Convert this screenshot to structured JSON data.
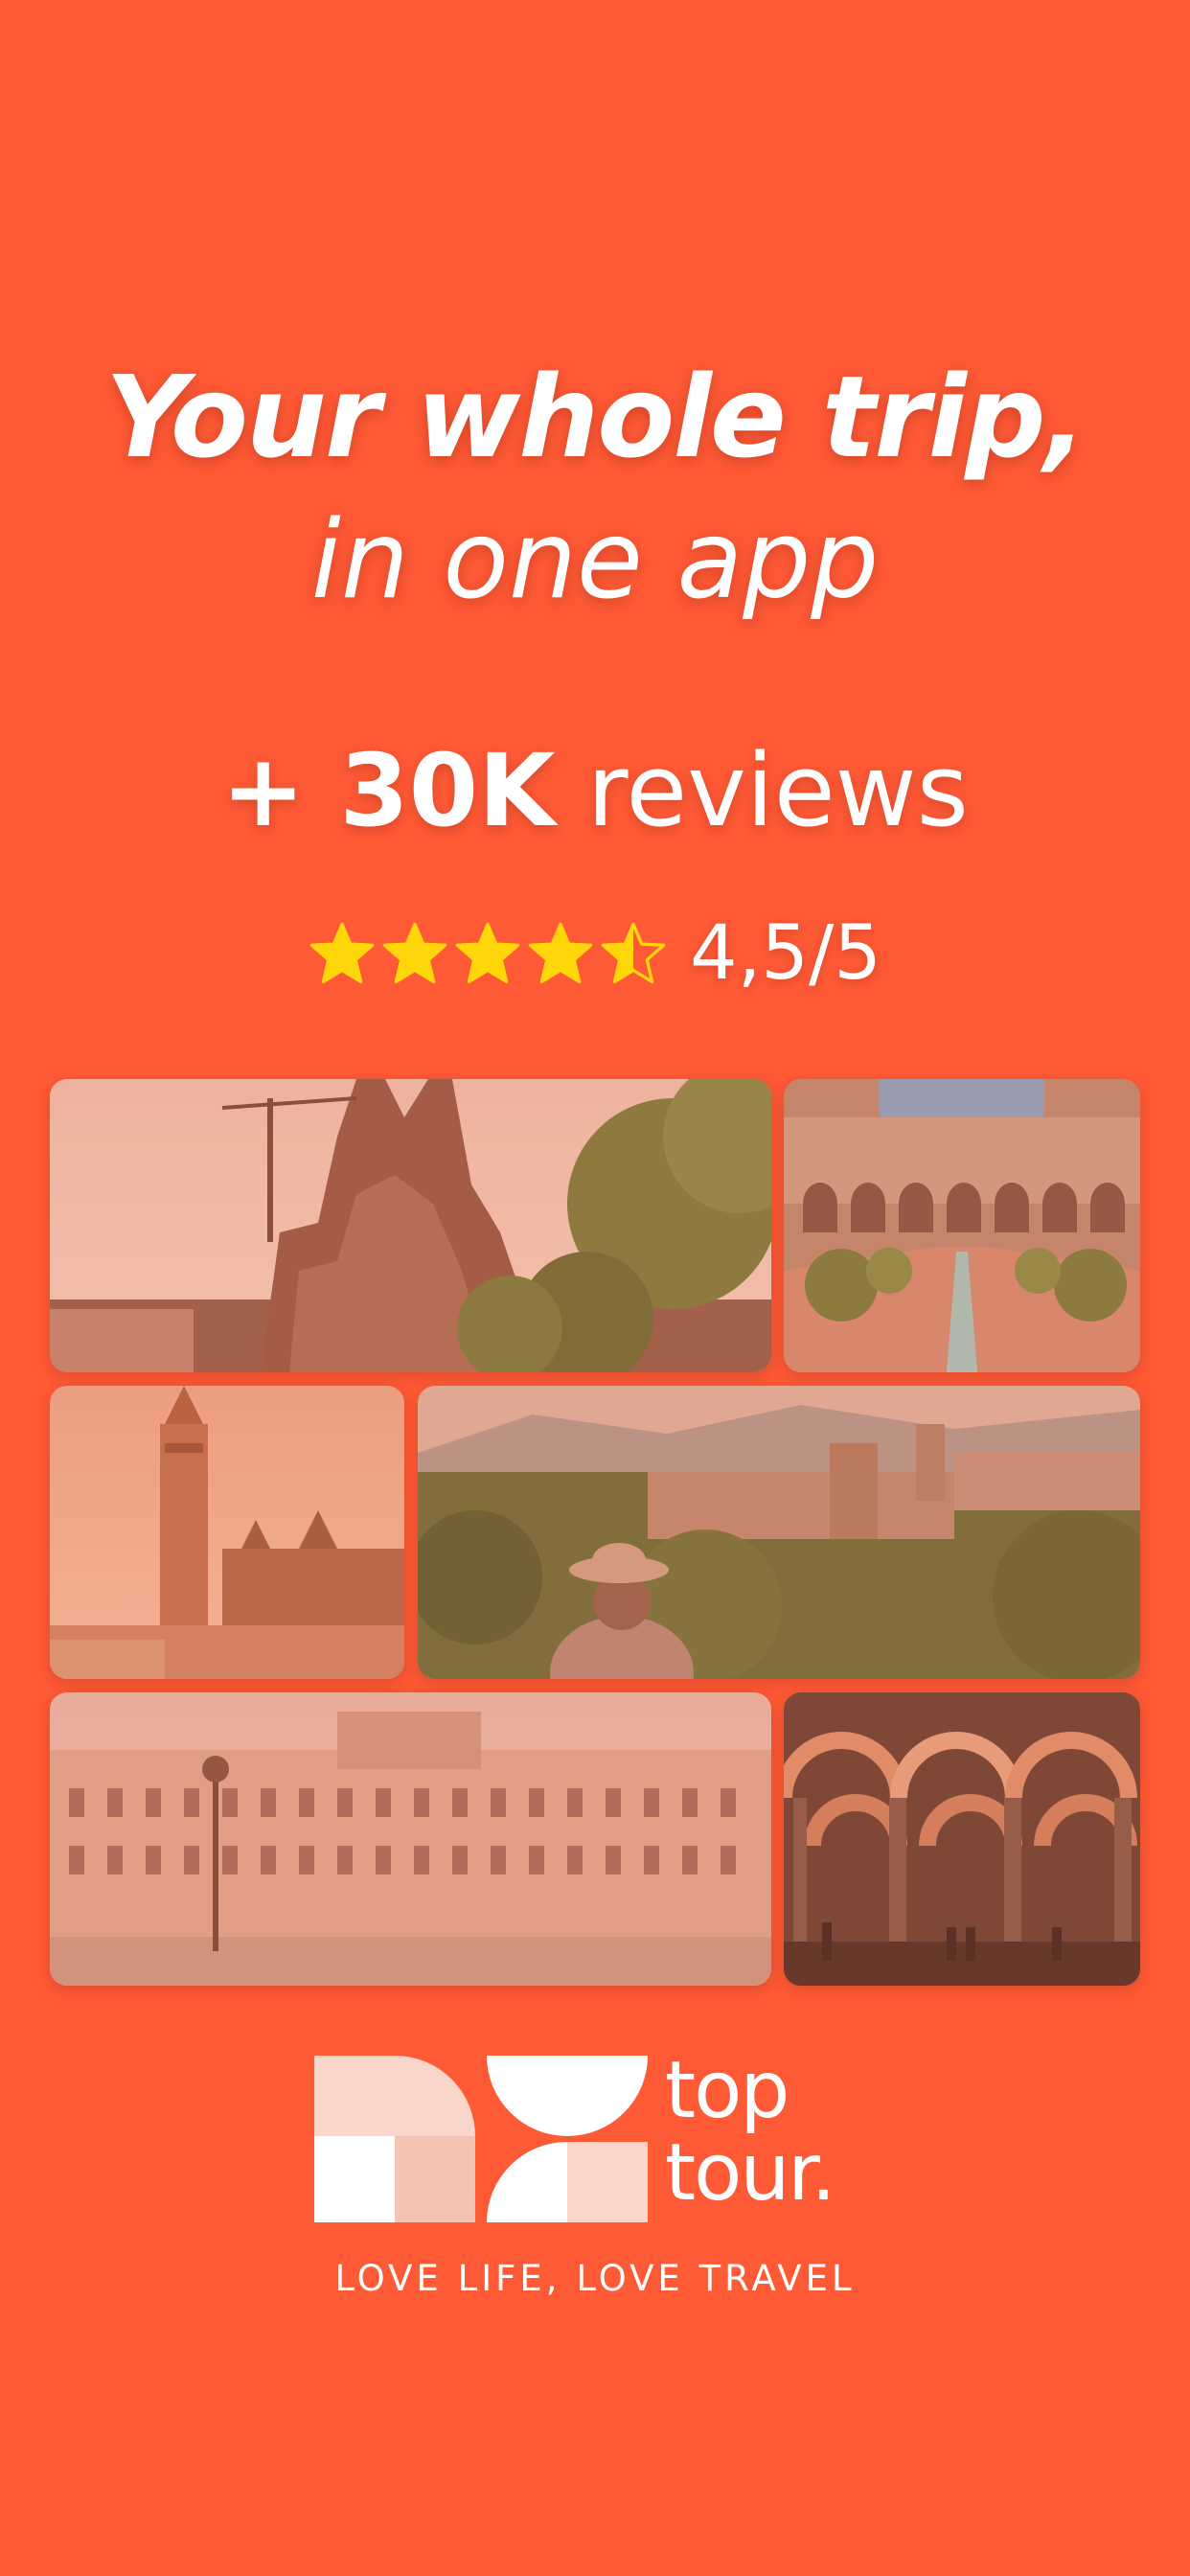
{
  "headline": {
    "line1": "Your whole trip,",
    "line2": "in one app"
  },
  "reviews": {
    "prefix": "+ 30K",
    "suffix": " reviews"
  },
  "rating": {
    "stars_value": 4.5,
    "stars_max": 5,
    "label": "4,5/5",
    "star_color": "#FFD60A"
  },
  "gallery": {
    "photos": [
      {
        "name": "sagrada-familia-photo"
      },
      {
        "name": "alcazar-courtyard-photo"
      },
      {
        "name": "giralda-tower-photo"
      },
      {
        "name": "alhambra-view-photo"
      },
      {
        "name": "royal-palace-photo"
      },
      {
        "name": "mezquita-arches-photo"
      }
    ]
  },
  "brand": {
    "name_line1": "top",
    "name_line2": "tour.",
    "tagline": "LOVE LIFE, LOVE TRAVEL"
  },
  "colors": {
    "background": "#FF5A36",
    "accent_pink": "#F9D6C9"
  }
}
